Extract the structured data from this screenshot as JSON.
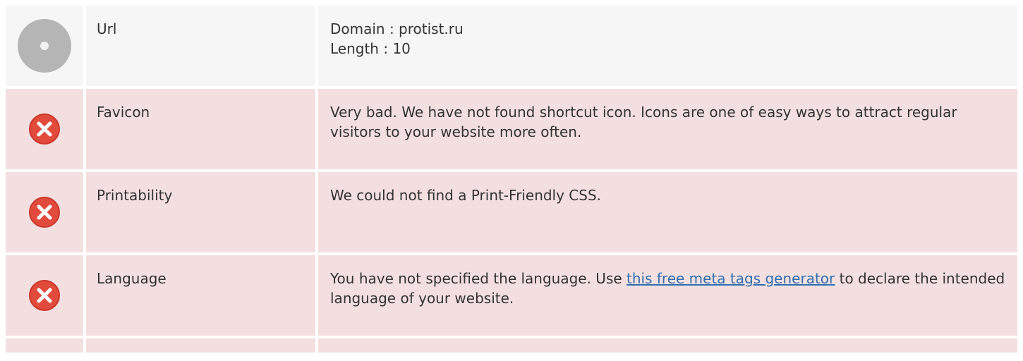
{
  "colors": {
    "neutral_bg": "#f6f6f6",
    "bad_bg": "#f3dfe0",
    "error_icon": "#e24b3c",
    "neutral_icon": "#b5b5b5",
    "link": "#2f6fae"
  },
  "rows": {
    "url": {
      "status": "neutral",
      "icon": "neutral-dot-icon",
      "name": "Url",
      "lines": [
        "Domain : protist.ru",
        "Length : 10"
      ]
    },
    "favicon": {
      "status": "bad",
      "icon": "error-x-icon",
      "name": "Favicon",
      "text": "Very bad. We have not found shortcut icon. Icons are one of easy ways to attract regular visitors to your website more often."
    },
    "printability": {
      "status": "bad",
      "icon": "error-x-icon",
      "name": "Printability",
      "text": "We could not find a Print-Friendly CSS."
    },
    "language": {
      "status": "bad",
      "icon": "error-x-icon",
      "name": "Language",
      "text_before": "You have not specified the language. Use ",
      "link_text": "this free meta tags generator",
      "text_after": " to declare the intended language of your website."
    }
  }
}
